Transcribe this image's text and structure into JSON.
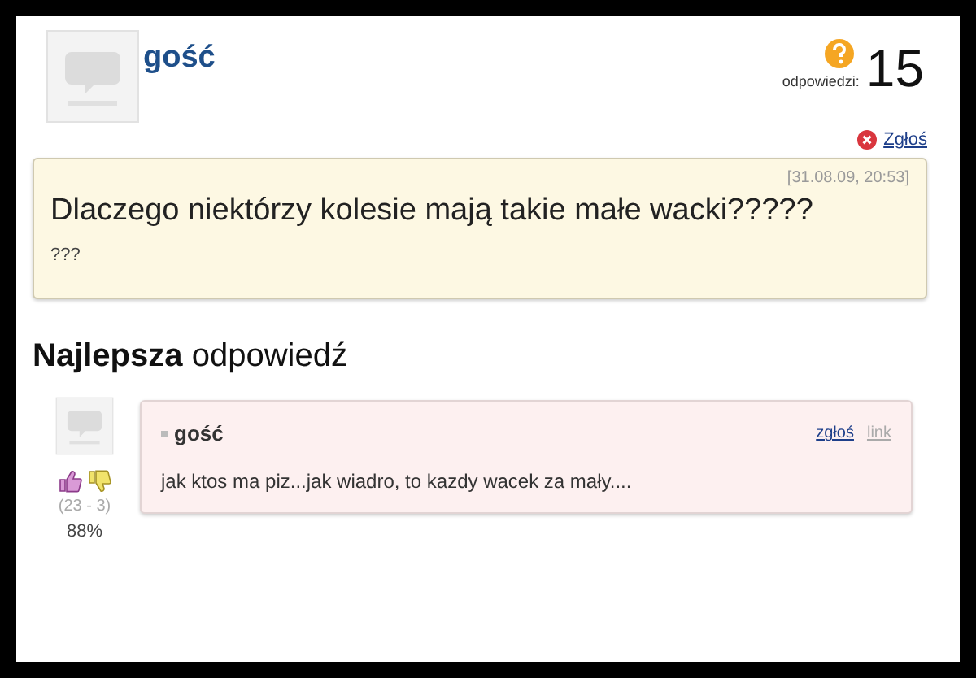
{
  "question": {
    "author": "gość",
    "answers_label": "odpowiedzi:",
    "answers_count": "15",
    "report": "Zgłoś",
    "date": "[31.08.09, 20:53]",
    "title": "Dlaczego niektórzy kolesie mają takie małe wacki?????",
    "body": "???"
  },
  "best_answer": {
    "heading_bold": "Najlepsza",
    "heading_rest": "odpowiedź",
    "votes": "(23 - 3)",
    "percent": "88%",
    "author": "gość",
    "report": "zgłoś",
    "link": "link",
    "text": "jak ktos ma piz...jak wiadro, to kazdy wacek za mały...."
  }
}
